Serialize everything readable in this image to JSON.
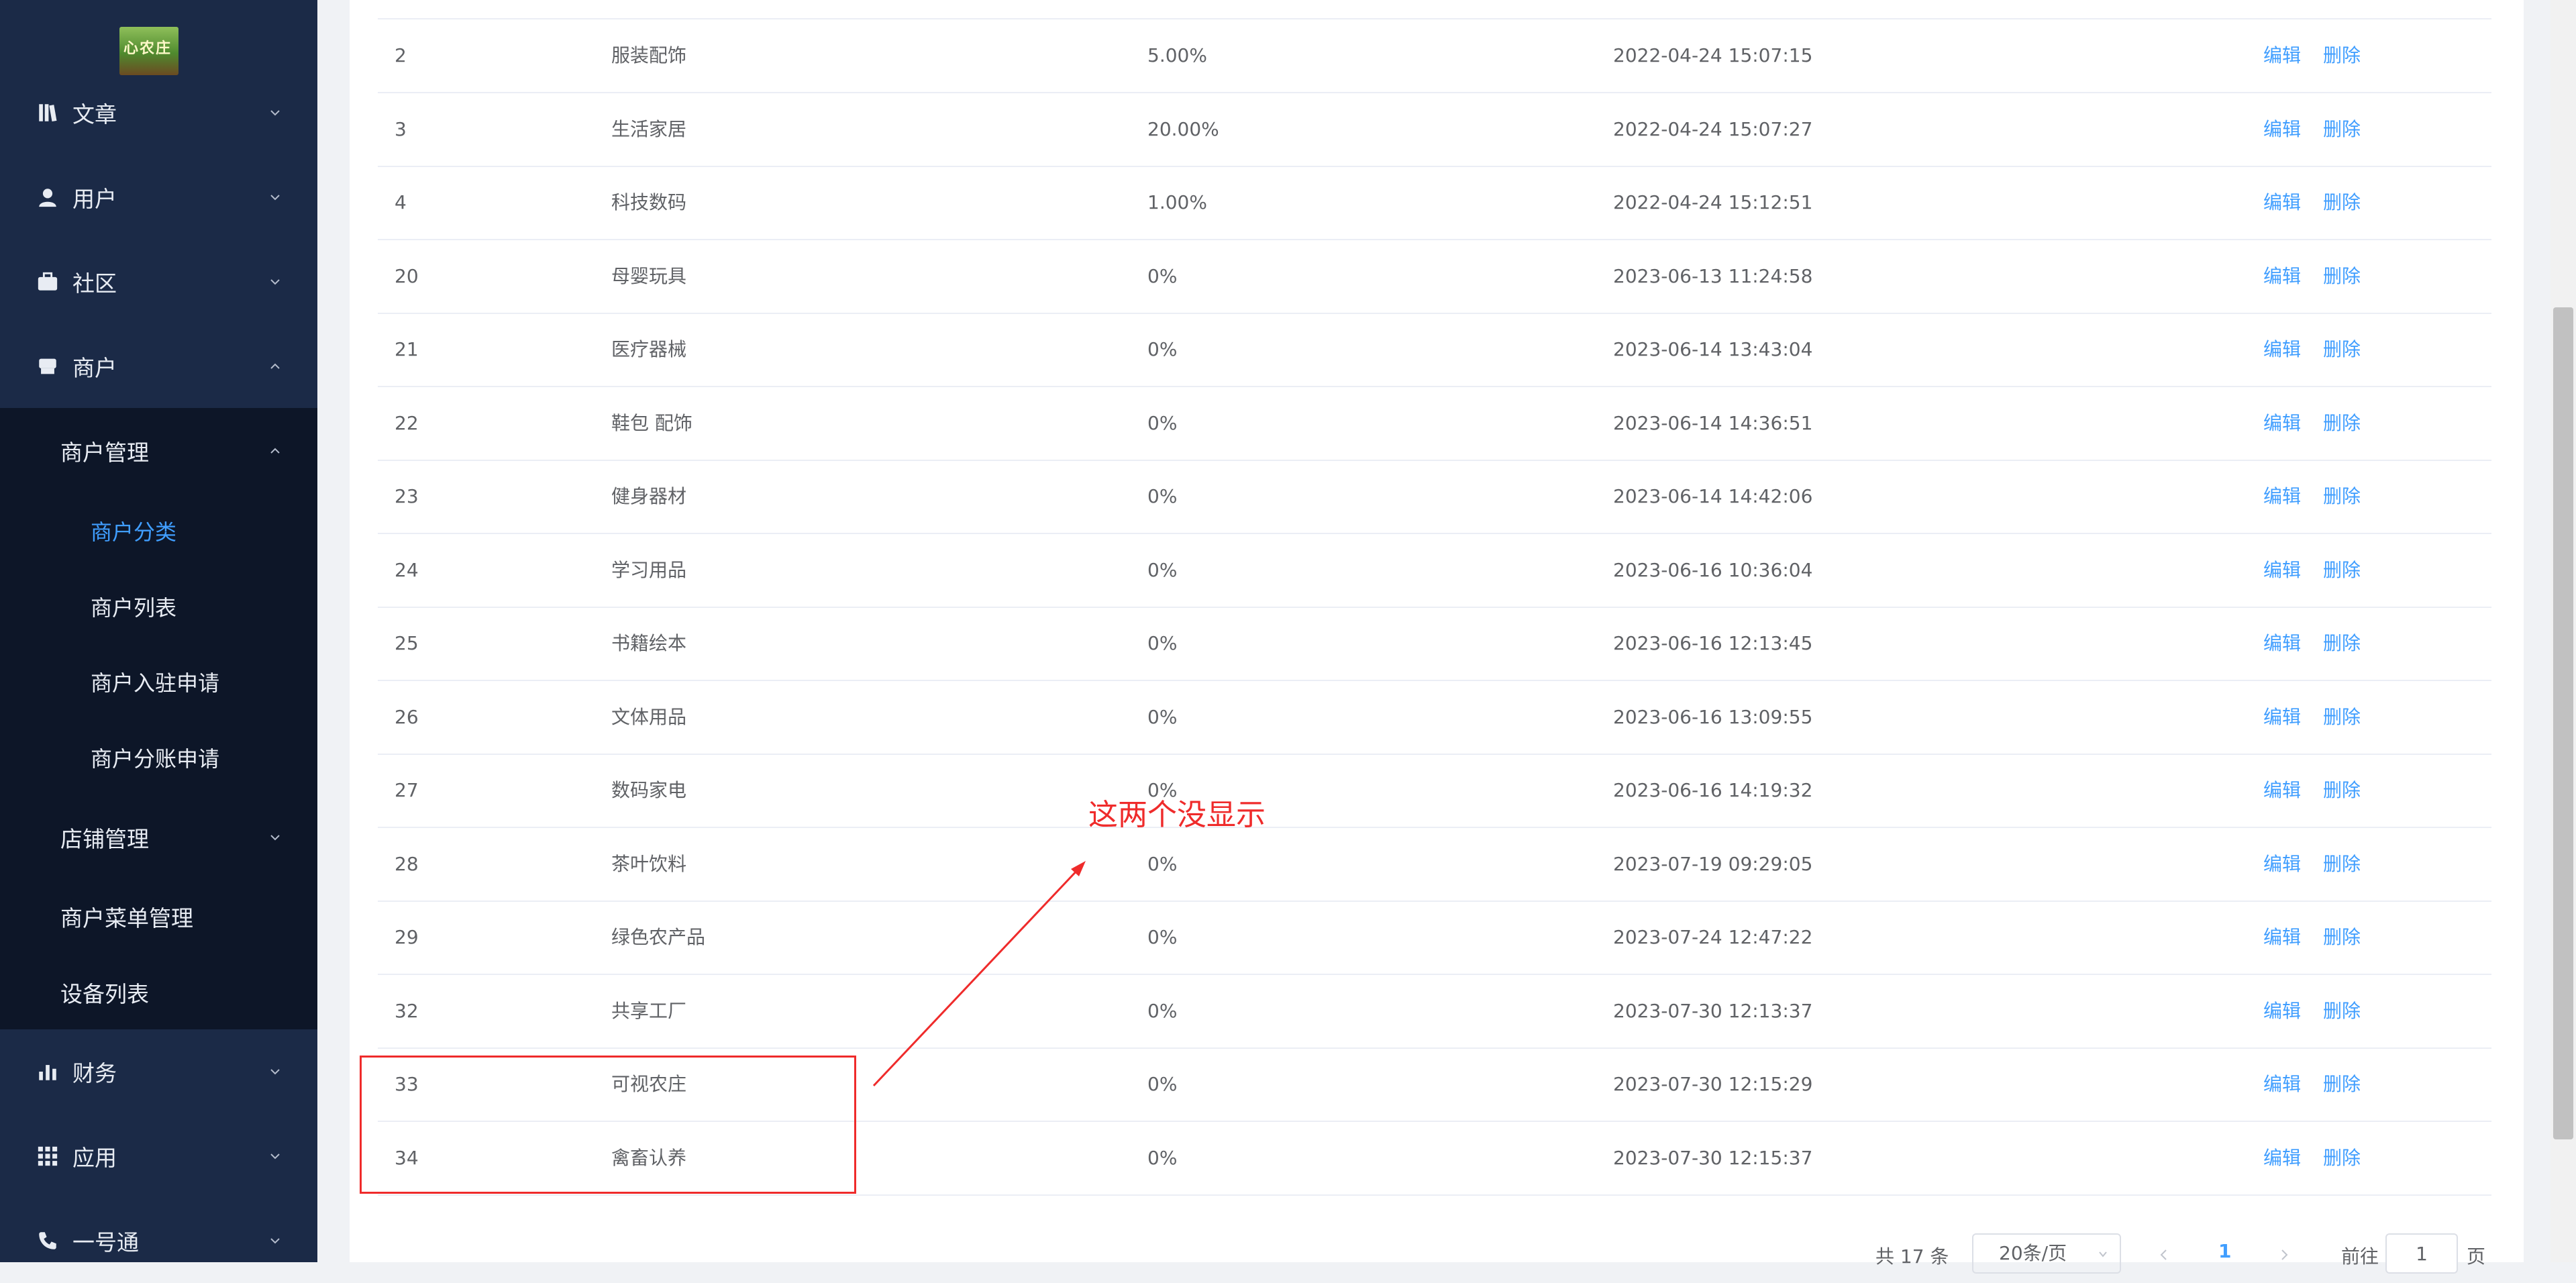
{
  "sidebar": {
    "logo_text": "心农庄",
    "menus": [
      {
        "label": "文章",
        "icon": "book-icon"
      },
      {
        "label": "用户",
        "icon": "user-icon"
      },
      {
        "label": "社区",
        "icon": "briefcase-icon"
      },
      {
        "label": "商户",
        "icon": "store-icon"
      },
      {
        "label": "财务",
        "icon": "bar-chart-icon"
      },
      {
        "label": "应用",
        "icon": "grid-icon"
      },
      {
        "label": "一号通",
        "icon": "phone-icon"
      }
    ],
    "submenu": {
      "merchant_mgmt": "商户管理",
      "items": [
        "商户分类",
        "商户列表",
        "商户入驻申请",
        "商户分账申请"
      ],
      "shop_mgmt": "店铺管理",
      "menu_mgmt": "商户菜单管理",
      "device_list": "设备列表"
    }
  },
  "table": {
    "rows": [
      {
        "id": "2",
        "name": "服装配饰",
        "rate": "5.00%",
        "time": "2022-04-24 15:07:15"
      },
      {
        "id": "3",
        "name": "生活家居",
        "rate": "20.00%",
        "time": "2022-04-24 15:07:27"
      },
      {
        "id": "4",
        "name": "科技数码",
        "rate": "1.00%",
        "time": "2022-04-24 15:12:51"
      },
      {
        "id": "20",
        "name": "母婴玩具",
        "rate": "0%",
        "time": "2023-06-13 11:24:58"
      },
      {
        "id": "21",
        "name": "医疗器械",
        "rate": "0%",
        "time": "2023-06-14 13:43:04"
      },
      {
        "id": "22",
        "name": "鞋包 配饰",
        "rate": "0%",
        "time": "2023-06-14 14:36:51"
      },
      {
        "id": "23",
        "name": "健身器材",
        "rate": "0%",
        "time": "2023-06-14 14:42:06"
      },
      {
        "id": "24",
        "name": "学习用品",
        "rate": "0%",
        "time": "2023-06-16 10:36:04"
      },
      {
        "id": "25",
        "name": "书籍绘本",
        "rate": "0%",
        "time": "2023-06-16 12:13:45"
      },
      {
        "id": "26",
        "name": "文体用品",
        "rate": "0%",
        "time": "2023-06-16 13:09:55"
      },
      {
        "id": "27",
        "name": "数码家电",
        "rate": "0%",
        "time": "2023-06-16 14:19:32"
      },
      {
        "id": "28",
        "name": "茶叶饮料",
        "rate": "0%",
        "time": "2023-07-19 09:29:05"
      },
      {
        "id": "29",
        "name": "绿色农产品",
        "rate": "0%",
        "time": "2023-07-24 12:47:22"
      },
      {
        "id": "32",
        "name": "共享工厂",
        "rate": "0%",
        "time": "2023-07-30 12:13:37"
      },
      {
        "id": "33",
        "name": "可视农庄",
        "rate": "0%",
        "time": "2023-07-30 12:15:29"
      },
      {
        "id": "34",
        "name": "禽畜认养",
        "rate": "0%",
        "time": "2023-07-30 12:15:37"
      }
    ],
    "edit_label": "编辑",
    "delete_label": "删除"
  },
  "annotation": {
    "text": "这两个没显示",
    "color": "#ef2b2b"
  },
  "pagination": {
    "total": "共 17 条",
    "page_size": "20条/页",
    "current_page": "1",
    "goto_label": "前往",
    "goto_value": "1",
    "page_suffix": "页"
  },
  "colors": {
    "sidebar_bg": "#1b2a47",
    "submenu_bg": "#0d1628",
    "accent": "#409eff",
    "annotation": "#ef2b2b"
  }
}
